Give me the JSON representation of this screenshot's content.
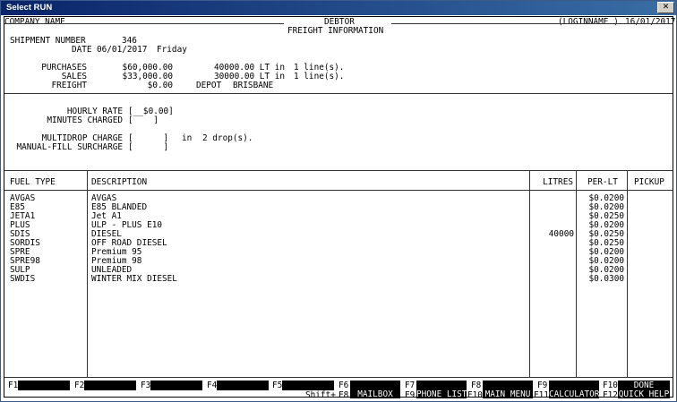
{
  "window": {
    "title": "Select RUN",
    "close_glyph": "✕"
  },
  "header": {
    "company": "COMPANY NAME",
    "title": "DEBTOR",
    "subtitle": "FREIGHT INFORMATION",
    "login": "(LOGINNAME )",
    "date": "16/01/2017"
  },
  "shipment": {
    "number_label": "SHIPMENT NUMBER",
    "number_value": "346",
    "date_label": "DATE",
    "date_value": "06/01/2017",
    "day_value": "Friday"
  },
  "totals": {
    "purchases_label": "PURCHASES",
    "purchases_value": "$60,000.00",
    "purchases_qty": "40000.00 LT in",
    "purchases_lines": "1 line(s).",
    "sales_label": "SALES",
    "sales_value": "$33,000.00",
    "sales_qty": "30000.00 LT in",
    "sales_lines": "1 line(s).",
    "freight_label": "FREIGHT",
    "freight_value": "$0.00",
    "depot_label": "DEPOT",
    "depot_value": "BRISBANE"
  },
  "charges": {
    "hourly_rate_label": "HOURLY RATE",
    "hourly_rate_value": "[__$0.00]",
    "minutes_label": "MINUTES CHARGED",
    "minutes_value": "[    ]",
    "multidrop_label": "MULTIDROP CHARGE",
    "multidrop_value": "[      ]",
    "multidrop_in": "in",
    "drops_value": "2 drop(s).",
    "manual_label": "MANUAL-FILL SURCHARGE",
    "manual_value": "[      ]"
  },
  "table": {
    "headers": {
      "fuel": "FUEL TYPE",
      "desc": "DESCRIPTION",
      "litres": "LITRES",
      "perlt": "PER-LT",
      "pickup": "PICKUP"
    },
    "fuel_types": "AVGAS\nE85\nJETA1\nPLUS\nSDIS\nSORDIS\nSPRE\nSPRE98\nSULP\nSWDIS",
    "descriptions": "AVGAS\nE85 BLANDED\nJet A1\nULP - PLUS E10\nDIESEL\nOFF ROAD DIESEL\nPremium 95\nPremium 98\nUNLEADED\nWINTER MIX DIESEL",
    "litres": "\n\n\n\n40000\n\n\n\n\n",
    "per_lt": "$0.0200\n$0.0200\n$0.0250\n$0.0200\n$0.0250\n$0.0250\n$0.0200\n$0.0200\n$0.0200\n$0.0300",
    "pickup": ""
  },
  "fkeys": {
    "f1": "F1",
    "f2": "F2",
    "f3": "F3",
    "f4": "F4",
    "f5": "F5",
    "f6": "F6",
    "f7": "F7",
    "f8": "F8",
    "f9": "F9",
    "f10": "F10",
    "shift": "Shift+",
    "sf8": "F8",
    "sf9": "F9",
    "sf10": "F10",
    "sf11": "F11",
    "sf12": "F12",
    "done": "DONE",
    "mailbox": "MAILBOX",
    "phone_list": "PHONE LIST",
    "main_menu": "MAIN MENU",
    "calculator": "CALCULATOR",
    "quick_help": "QUICK HELP"
  }
}
